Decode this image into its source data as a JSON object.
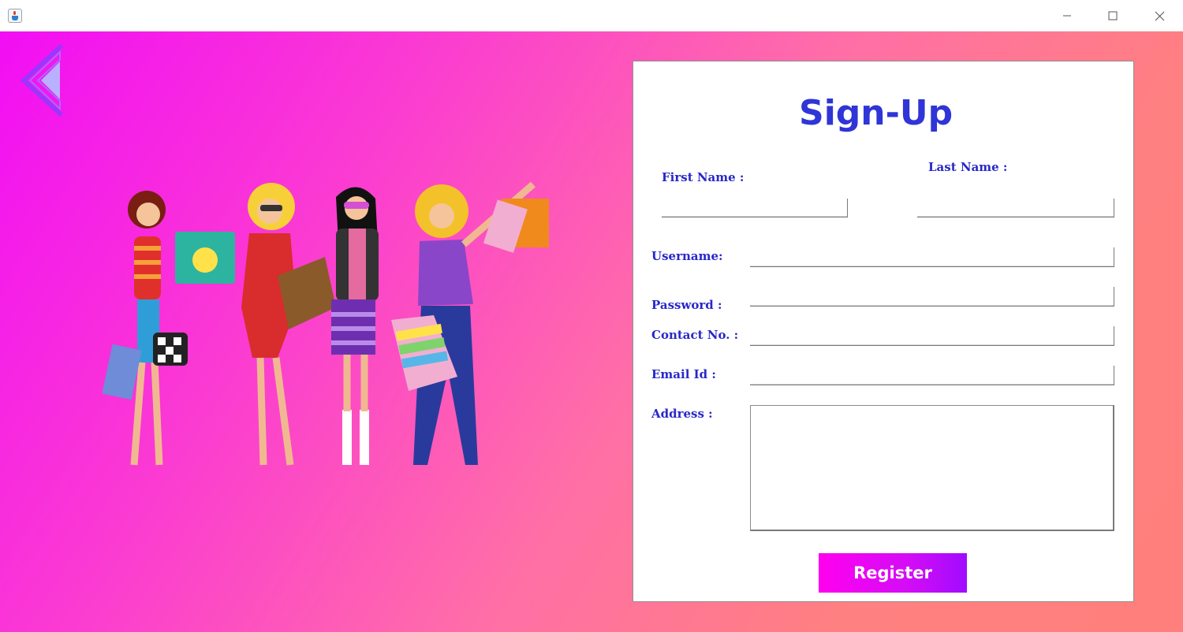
{
  "window": {
    "minimize_glyph": "─",
    "maximize_glyph": "☐",
    "close_glyph": "✕"
  },
  "signup": {
    "title": "Sign-Up",
    "first_name_label": "First Name :",
    "last_name_label": "Last Name :",
    "username_label": "Username:",
    "password_label": "Password :",
    "contact_label": "Contact No. :",
    "email_label": "Email Id :",
    "address_label": "Address :",
    "first_name_value": "",
    "last_name_value": "",
    "username_value": "",
    "password_value": "",
    "contact_value": "",
    "email_value": "",
    "address_value": "",
    "register_label": "Register"
  },
  "icons": {
    "back": "back-arrow-icon",
    "illustration": "shopping-women-illustration"
  },
  "colors": {
    "label_blue": "#2828c8",
    "title_blue": "#2f35d6",
    "background_start": "#f20ef4",
    "background_end": "#ff7f7c",
    "register_start": "#ff00ee",
    "register_end": "#a10bff"
  }
}
